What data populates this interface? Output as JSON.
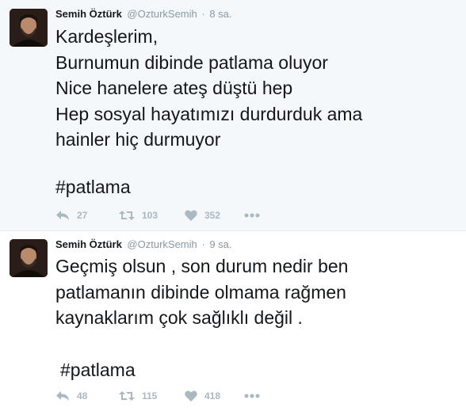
{
  "tweets": [
    {
      "author_name": "Semih Öztürk",
      "handle": "@OzturkSemih",
      "separator": "·",
      "time": "8 sa.",
      "text": "Kardeşlerim,\nBurnumun dibinde patlama oluyor\nNice hanelere ateş düştü hep\nHep sosyal hayatımızı durdurduk ama\nhainler hiç durmuyor",
      "hashtag": "#patlama",
      "replies": "27",
      "retweets": "103",
      "likes": "352"
    },
    {
      "author_name": "Semih Öztürk",
      "handle": "@OzturkSemih",
      "separator": "·",
      "time": "9 sa.",
      "text": "Geçmiş olsun , son durum nedir ben\npatlamanın dibinde olmama rağmen\nkaynaklarım çok sağlıklı değil .",
      "hashtag": "#patlama",
      "replies": "48",
      "retweets": "115",
      "likes": "418"
    }
  ],
  "icons": {
    "reply": "reply-icon",
    "retweet": "retweet-icon",
    "like": "heart-icon",
    "more": "more-dots-icon"
  },
  "colors": {
    "highlight_bg": "#f5f8fa",
    "action_gray": "#aab8c2",
    "meta_gray": "#8899a6",
    "divider": "#e6ecf0"
  }
}
